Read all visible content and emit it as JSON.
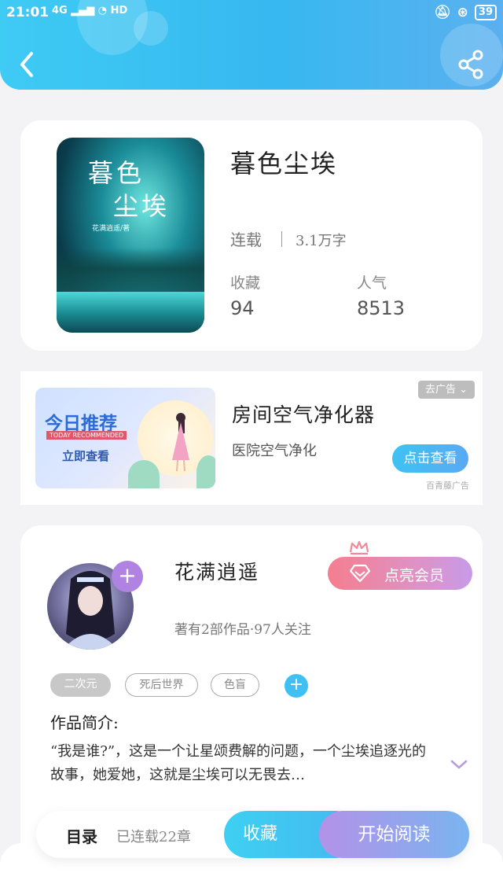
{
  "status_bar": {
    "time": "21:01",
    "signal": "4G",
    "hd": "HD",
    "battery": "39"
  },
  "header": {
    "back_icon": "chevron-left-icon",
    "share_icon": "share-icon"
  },
  "book": {
    "cover_title_line1": "暮色",
    "cover_title_line2": "尘埃",
    "cover_author": "花满逍遥/著",
    "title": "暮色尘埃",
    "status": "连载",
    "word_count": "3.1万字",
    "favorites_label": "收藏",
    "favorites_value": "94",
    "popularity_label": "人气",
    "popularity_value": "8513"
  },
  "ad": {
    "image_text_main": "今日推荐",
    "image_text_eng": "TODAY RECOMMENDED",
    "image_text_cta": "立即查看",
    "title": "房间空气净化器",
    "subtitle": "医院空气净化",
    "remove_label": "去广告 ⌄",
    "cta_label": "点击查看",
    "source": "百青藤广告"
  },
  "author": {
    "name": "花满逍遥",
    "meta": "著有2部作品·97人关注",
    "vip_label": "点亮会员",
    "tags": [
      "二次元",
      "死后世界",
      "色盲"
    ],
    "intro_heading": "作品简介:",
    "intro_text": "“我是谁?”，这是一个让星颂费解的问题，一个尘埃追逐光的故事，她爱她，这就是尘埃可以无畏去…"
  },
  "bottom_bar": {
    "toc_label": "目录",
    "chapter_count": "已连载22章",
    "collect_label": "收藏",
    "read_label": "开始阅读"
  },
  "colors": {
    "header_blue": "#3ecbf4",
    "vip_pink": "#f47e8e",
    "accent_purple": "#b083e2"
  }
}
